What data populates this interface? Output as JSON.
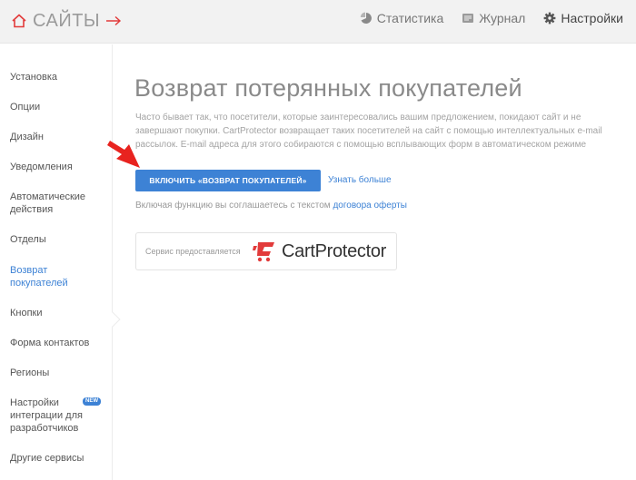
{
  "header": {
    "brand": "САЙТЫ",
    "nav": [
      {
        "label": "Статистика",
        "icon": "pie-chart-icon"
      },
      {
        "label": "Журнал",
        "icon": "journal-icon"
      },
      {
        "label": "Настройки",
        "icon": "gear-icon"
      }
    ]
  },
  "sidebar": {
    "items": [
      {
        "label": "Установка"
      },
      {
        "label": "Опции"
      },
      {
        "label": "Дизайн"
      },
      {
        "label": "Уведомления"
      },
      {
        "label": "Автоматические действия"
      },
      {
        "label": "Отделы"
      },
      {
        "label": "Возврат покупателей"
      },
      {
        "label": "Кнопки"
      },
      {
        "label": "Форма контактов"
      },
      {
        "label": "Регионы"
      },
      {
        "label": "Настройки интеграции для разработчиков"
      },
      {
        "label": "Другие сервисы"
      }
    ],
    "active_index": 6,
    "badge": "NEW"
  },
  "main": {
    "title": "Возврат потерянных покупателей",
    "description": "Часто бывает так, что посетители, которые заинтересовались вашим предложением, покидают сайт и не завершают покупки. CartProtector возвращает таких посетителей на сайт с помощью интеллектуальных e-mail рассылок. E-mail адреса для этого собираются с помощью всплывающих форм в автоматическом режиме",
    "enable_button": "ВКЛЮЧИТЬ «ВОЗВРАТ ПОКУПАТЕЛЕЙ»",
    "learn_more": "Узнать больше",
    "agree_text": "Включая функцию вы соглашаетесь с текстом",
    "agree_link": "договора оферты",
    "provider_label": "Сервис предоставляется",
    "provider_name": "CartProtector"
  },
  "colors": {
    "accent": "#3d82d5",
    "brand_red": "#e23b3b",
    "topbar_bg": "#f2f2f2"
  }
}
